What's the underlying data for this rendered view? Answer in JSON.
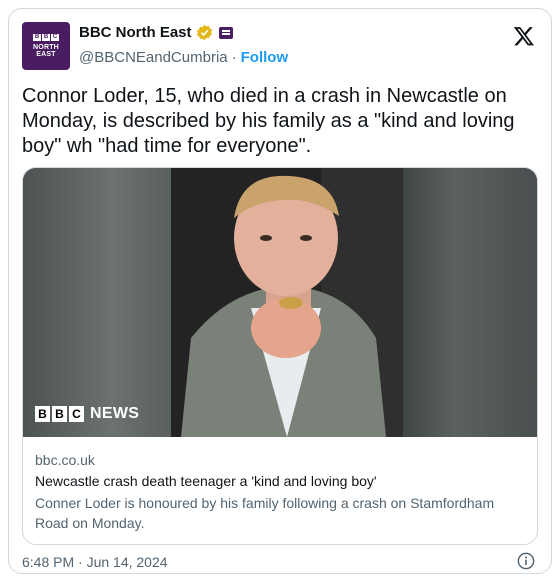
{
  "account": {
    "display_name": "BBC North East",
    "handle": "@BBCNEandCumbria",
    "separator": "·",
    "follow_label": "Follow",
    "avatar_letters": [
      "B",
      "B",
      "C"
    ],
    "avatar_line1": "NORTH",
    "avatar_line2": "EAST",
    "brand_color": "#4a1d63"
  },
  "tweet": {
    "text": "Connor Loder, 15, who died in a crash in Newcastle on Monday, is described by his family as a \"kind and loving boy\" wh \"had time for everyone\"."
  },
  "card": {
    "watermark_letters": [
      "B",
      "B",
      "C"
    ],
    "watermark_word": "NEWS",
    "domain": "bbc.co.uk",
    "title": "Newcastle crash death teenager a 'kind and loving boy'",
    "description": "Conner Loder is honoured by his family following a crash on Stamfordham Road on Monday."
  },
  "meta": {
    "timestamp": "6:48 PM · Jun 14, 2024"
  },
  "icons": {
    "verified": "verified-badge-icon",
    "org": "organization-badge-icon",
    "logo": "x-logo-icon",
    "info": "info-icon"
  }
}
